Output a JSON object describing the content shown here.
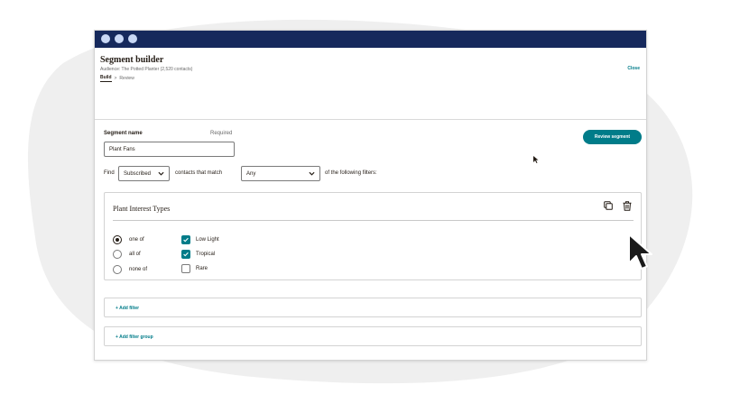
{
  "colors": {
    "titlebar": "#16295c",
    "window_dots": "#c9d8f5",
    "accent": "#007c89",
    "text": "#241c15",
    "backdrop_blob": "#efefef"
  },
  "header": {
    "title": "Segment builder",
    "audience": "Audience: The Potted Planter (2,520 contacts)",
    "breadcrumb": {
      "build": "Build",
      "separator": ">",
      "review": "Review"
    },
    "close_label": "Close"
  },
  "segment": {
    "name_label": "Segment name",
    "required_label": "Required",
    "name_value": "Plant Fans",
    "review_button": "Review segment"
  },
  "find_row": {
    "find_label": "Find",
    "status_select": "Subscribed",
    "contacts_match_label": "contacts that match",
    "match_select": "Any",
    "following_label": "of the following filters:"
  },
  "filter_group": {
    "title": "Plant Interest Types",
    "copy_icon": "copy-icon",
    "trash_icon": "trash-icon",
    "operators": [
      {
        "label": "one of",
        "selected": true
      },
      {
        "label": "all of",
        "selected": false
      },
      {
        "label": "none of",
        "selected": false
      }
    ],
    "options": [
      {
        "label": "Low Light",
        "checked": true
      },
      {
        "label": "Tropical",
        "checked": true
      },
      {
        "label": "Rare",
        "checked": false
      }
    ]
  },
  "actions": {
    "add_filter": "+ Add filter",
    "add_filter_group": "+ Add filter group"
  }
}
